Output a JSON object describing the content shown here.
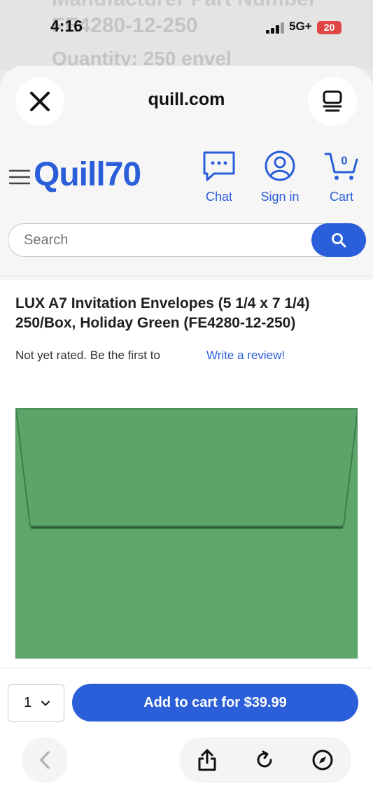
{
  "status_bar": {
    "time": "4:16",
    "network": "5G+",
    "battery": "20",
    "background_text_line1": "Manufacturer Part Number",
    "background_text_line2": "FE4280-12-250",
    "background_text_line3": "Quantity: 250 envel"
  },
  "browser": {
    "domain": "quill.com"
  },
  "site_header": {
    "logo": "Quill70",
    "nav": {
      "chat": "Chat",
      "sign_in": "Sign in",
      "cart": "Cart",
      "cart_count": "0"
    },
    "search": {
      "placeholder": "Search"
    }
  },
  "product": {
    "title": "LUX A7 Invitation Envelopes (5 1/4 x 7 1/4) 250/Box, Holiday Green (FE4280-12-250)",
    "rating_text": "Not yet rated. Be the first to",
    "review_link": "Write a review!",
    "image_color": "#5ba66a"
  },
  "cart_bar": {
    "quantity": "1",
    "add_to_cart": "Add to cart for $39.99"
  },
  "colors": {
    "brand": "#2b5ed9",
    "sheet": "#f6f6f6"
  }
}
